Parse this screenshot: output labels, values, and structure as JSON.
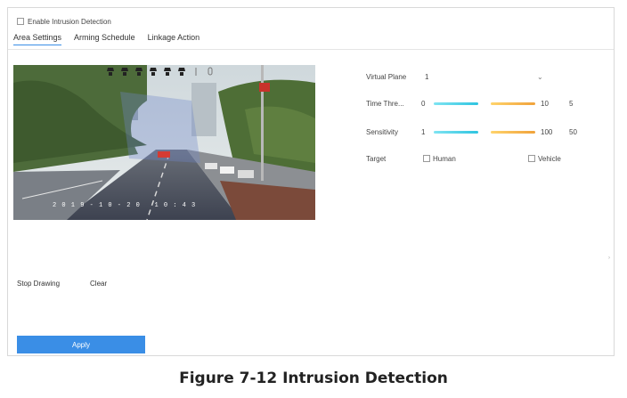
{
  "enable": {
    "label": "Enable Intrusion Detection",
    "checked": false
  },
  "tabs": [
    "Area Settings",
    "Arming Schedule",
    "Linkage Action"
  ],
  "active_tab": 0,
  "preview": {
    "osd_date": "2 0 1 9 - 1 0 - 2 0",
    "osd_time": "1 0 : 4 3"
  },
  "toolbar_icons": [
    "camera-icon",
    "camera-icon",
    "camera-icon",
    "camera-icon",
    "camera-icon",
    "camera-icon",
    "divider-icon",
    "mouse-icon",
    "gear-icon",
    "flag-icon",
    "settings-icon"
  ],
  "settings": {
    "virtual_plane": {
      "label": "Virtual Plane",
      "value": "1"
    },
    "time_threshold": {
      "label": "Time Thre...",
      "min": "0",
      "max": "10",
      "value": "5"
    },
    "sensitivity": {
      "label": "Sensitivity",
      "min": "1",
      "max": "100",
      "value": "50"
    },
    "target": {
      "label": "Target",
      "human": "Human",
      "vehicle": "Vehicle"
    }
  },
  "actions": {
    "stop_drawing": "Stop Drawing",
    "clear": "Clear"
  },
  "apply_label": "Apply",
  "caption": "Figure 7-12 Intrusion Detection",
  "colors": {
    "accent": "#3a8ee6",
    "slider_cyan": "#2fc4e0",
    "slider_orange": "#f0a23b"
  }
}
